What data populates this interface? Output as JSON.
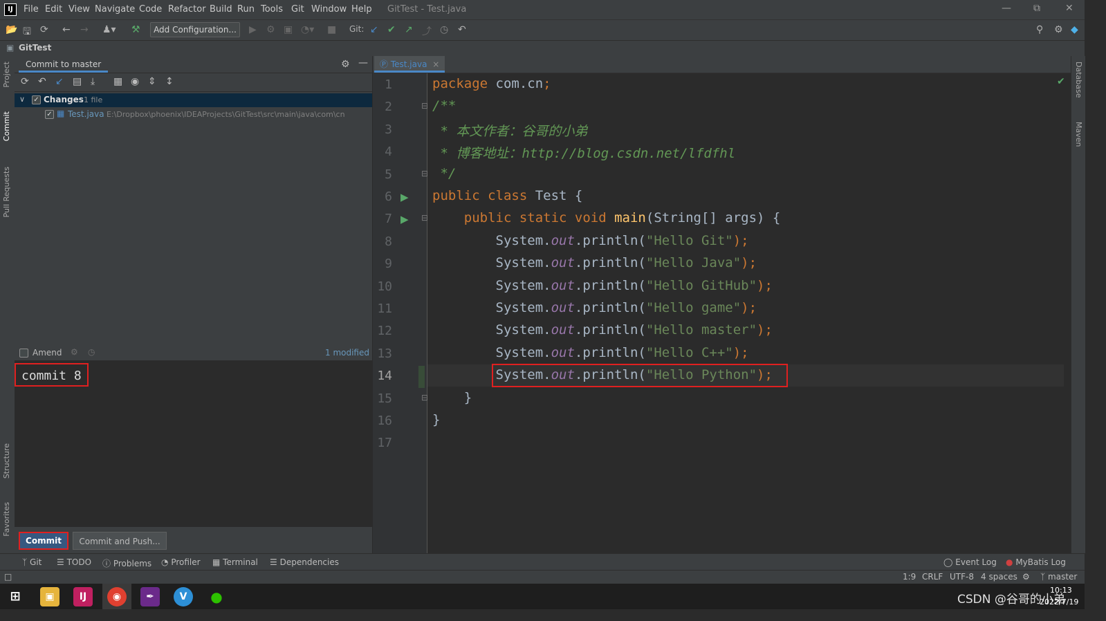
{
  "window": {
    "title": "GitTest - Test.java",
    "menu": [
      "File",
      "Edit",
      "View",
      "Navigate",
      "Code",
      "Refactor",
      "Build",
      "Run",
      "Tools",
      "Git",
      "Window",
      "Help"
    ]
  },
  "toolbar": {
    "add_configuration": "Add Configuration...",
    "git_label": "Git:"
  },
  "breadcrumb": {
    "project": "GitTest"
  },
  "left_tabs": [
    "Project",
    "Commit",
    "Pull Requests",
    "Structure",
    "Favorites"
  ],
  "right_tabs": [
    "Database",
    "Maven"
  ],
  "commit_panel": {
    "tab": "Commit to master",
    "changes_label": "Changes",
    "changes_count": "1 file",
    "file_name": "Test.java",
    "file_path": "E:\\Dropbox\\phoenix\\IDEAProjects\\GitTest\\src\\main\\java\\com\\cn",
    "amend_label": "Amend",
    "modified_label": "1 modified",
    "message": "commit 8",
    "commit_button": "Commit",
    "commit_push_button": "Commit and Push..."
  },
  "editor": {
    "tab": "Test.java",
    "line_numbers": [
      "1",
      "2",
      "3",
      "4",
      "5",
      "6",
      "7",
      "8",
      "9",
      "10",
      "11",
      "12",
      "13",
      "14",
      "15",
      "16",
      "17"
    ],
    "lines": [
      [
        {
          "t": "package ",
          "c": "kw"
        },
        {
          "t": "com.cn",
          "c": ""
        },
        {
          "t": ";",
          "c": "kw"
        }
      ],
      [
        {
          "t": "/**",
          "c": "cmt"
        }
      ],
      [
        {
          "t": " * 本文作者：谷哥的小弟",
          "c": "cmt"
        }
      ],
      [
        {
          "t": " * 博客地址：http://blog.csdn.net/lfdfhl",
          "c": "cmt"
        }
      ],
      [
        {
          "t": " */",
          "c": "cmt"
        }
      ],
      [
        {
          "t": "public class ",
          "c": "kw"
        },
        {
          "t": "Test {",
          "c": ""
        }
      ],
      [
        {
          "t": "    public static void ",
          "c": "kw"
        },
        {
          "t": "main",
          "c": "fn"
        },
        {
          "t": "(String[] args) {",
          "c": ""
        }
      ],
      [
        {
          "t": "        System.",
          "c": ""
        },
        {
          "t": "out",
          "c": "fld"
        },
        {
          "t": ".println(",
          "c": ""
        },
        {
          "t": "\"Hello Git\"",
          "c": "str"
        },
        {
          "t": ");",
          "c": "kw"
        }
      ],
      [
        {
          "t": "        System.",
          "c": ""
        },
        {
          "t": "out",
          "c": "fld"
        },
        {
          "t": ".println(",
          "c": ""
        },
        {
          "t": "\"Hello Java\"",
          "c": "str"
        },
        {
          "t": ");",
          "c": "kw"
        }
      ],
      [
        {
          "t": "        System.",
          "c": ""
        },
        {
          "t": "out",
          "c": "fld"
        },
        {
          "t": ".println(",
          "c": ""
        },
        {
          "t": "\"Hello GitHub\"",
          "c": "str"
        },
        {
          "t": ");",
          "c": "kw"
        }
      ],
      [
        {
          "t": "        System.",
          "c": ""
        },
        {
          "t": "out",
          "c": "fld"
        },
        {
          "t": ".println(",
          "c": ""
        },
        {
          "t": "\"Hello game\"",
          "c": "str"
        },
        {
          "t": ");",
          "c": "kw"
        }
      ],
      [
        {
          "t": "        System.",
          "c": ""
        },
        {
          "t": "out",
          "c": "fld"
        },
        {
          "t": ".println(",
          "c": ""
        },
        {
          "t": "\"Hello master\"",
          "c": "str"
        },
        {
          "t": ");",
          "c": "kw"
        }
      ],
      [
        {
          "t": "        System.",
          "c": ""
        },
        {
          "t": "out",
          "c": "fld"
        },
        {
          "t": ".println(",
          "c": ""
        },
        {
          "t": "\"Hello C++\"",
          "c": "str"
        },
        {
          "t": ");",
          "c": "kw"
        }
      ],
      [
        {
          "t": "        System.",
          "c": ""
        },
        {
          "t": "out",
          "c": "fld"
        },
        {
          "t": ".println(",
          "c": ""
        },
        {
          "t": "\"Hello Python\"",
          "c": "str"
        },
        {
          "t": ");",
          "c": "kw"
        }
      ],
      [
        {
          "t": "    }",
          "c": ""
        }
      ],
      [
        {
          "t": "}",
          "c": ""
        }
      ],
      [
        {
          "t": "",
          "c": ""
        }
      ]
    ]
  },
  "tool_windows": [
    "Git",
    "TODO",
    "Problems",
    "Profiler",
    "Terminal",
    "Dependencies"
  ],
  "tool_windows_right": [
    "Event Log",
    "MyBatis Log"
  ],
  "status": {
    "position": "1:9",
    "line_sep": "CRLF",
    "encoding": "UTF-8",
    "indent": "4 spaces",
    "branch": "master"
  },
  "taskbar": {
    "watermark": "CSDN @谷哥的小弟",
    "time": "10:13",
    "date": "2022/7/19"
  },
  "colors": {
    "keyword": "#cc7832",
    "comment": "#629755",
    "string": "#6a8759",
    "field": "#9876aa",
    "method": "#ffc66d",
    "highlight": "#e02020",
    "primary_button": "#365880"
  }
}
